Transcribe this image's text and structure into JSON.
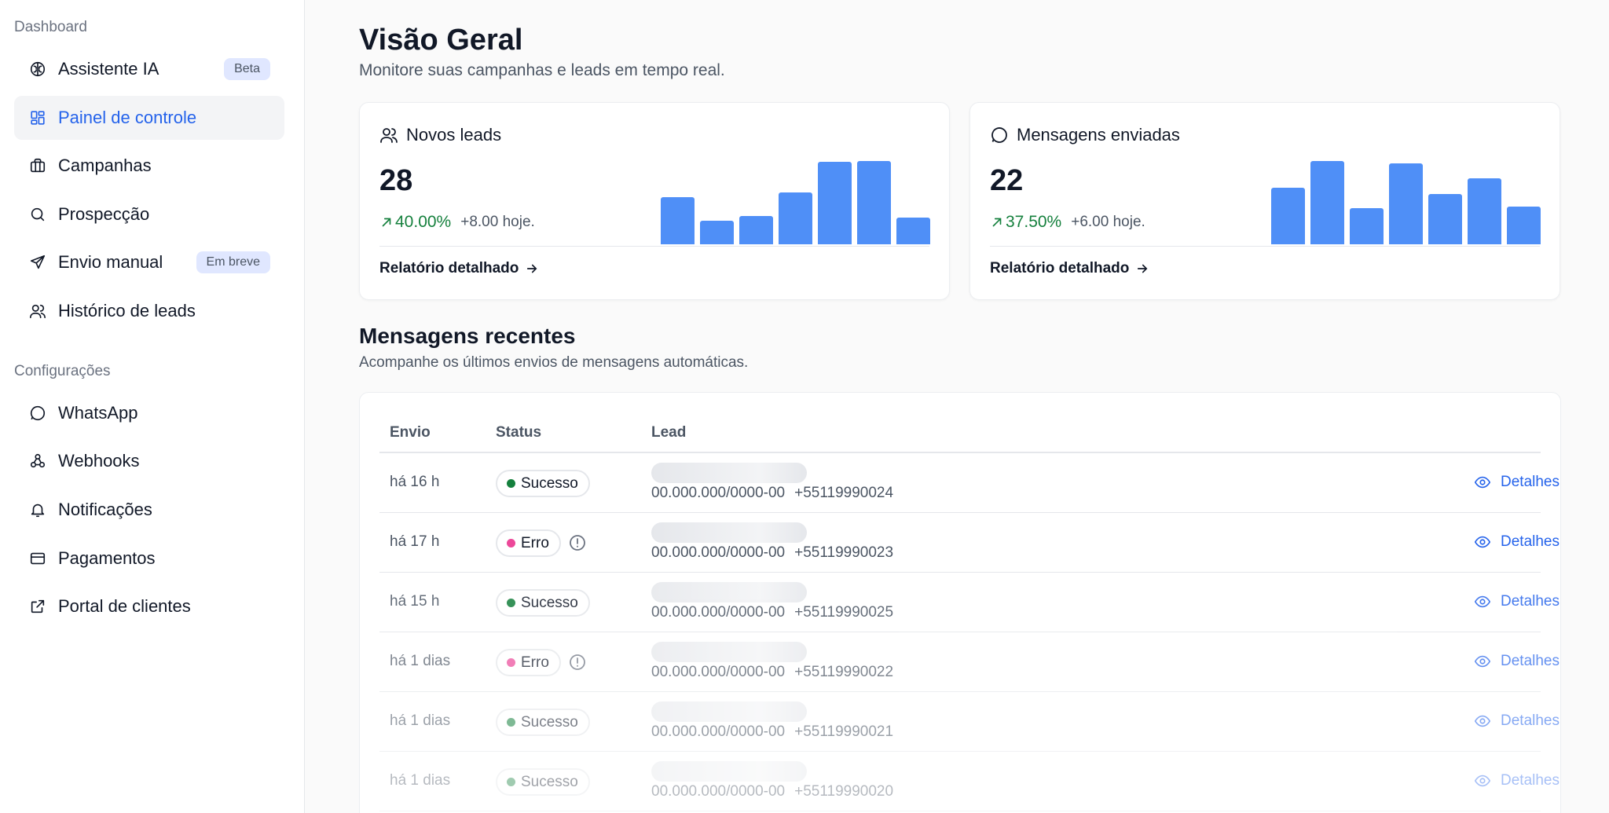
{
  "sidebar": {
    "sections": [
      {
        "label": "Dashboard"
      },
      {
        "label": "Configurações"
      }
    ],
    "items": [
      {
        "label": "Assistente IA",
        "icon": "brain-icon",
        "badge": "Beta"
      },
      {
        "label": "Painel de controle",
        "icon": "dashboard-icon",
        "active": true
      },
      {
        "label": "Campanhas",
        "icon": "briefcase-icon"
      },
      {
        "label": "Prospecção",
        "icon": "search-icon"
      },
      {
        "label": "Envio manual",
        "icon": "send-icon",
        "badge": "Em breve"
      },
      {
        "label": "Histórico de leads",
        "icon": "users-icon"
      },
      {
        "label": "WhatsApp",
        "icon": "message-circle-icon"
      },
      {
        "label": "Webhooks",
        "icon": "webhook-icon"
      },
      {
        "label": "Notificações",
        "icon": "bell-icon"
      },
      {
        "label": "Pagamentos",
        "icon": "credit-card-icon"
      },
      {
        "label": "Portal de clientes",
        "icon": "external-link-icon"
      }
    ]
  },
  "header": {
    "title": "Visão Geral",
    "subtitle": "Monitore suas campanhas e leads em tempo real."
  },
  "cards": [
    {
      "title": "Novos leads",
      "icon": "users-icon",
      "value": "28",
      "percent": "40.00%",
      "today": "+8.00 hoje.",
      "link": "Relatório detalhado",
      "bars": [
        4,
        2,
        2.4,
        4.4,
        7,
        7.1,
        2.3
      ]
    },
    {
      "title": "Mensagens enviadas",
      "icon": "message-circle-icon",
      "value": "22",
      "percent": "37.50%",
      "today": "+6.00 hoje.",
      "link": "Relatório detalhado",
      "bars": [
        4.8,
        7.1,
        3.1,
        6.9,
        4.3,
        5.6,
        3.2
      ]
    }
  ],
  "recent": {
    "title": "Mensagens recentes",
    "subtitle": "Acompanhe os últimos envios de mensagens automáticas.",
    "columns": [
      "Envio",
      "Status",
      "Lead"
    ],
    "details_label": "Detalhes",
    "rows": [
      {
        "envio": "há 16 h",
        "status": "Sucesso",
        "lead_doc": "00.000.000/0000-00",
        "phone": "+55119990024"
      },
      {
        "envio": "há 17 h",
        "status": "Erro",
        "lead_doc": "00.000.000/0000-00",
        "phone": "+55119990023"
      },
      {
        "envio": "há 15 h",
        "status": "Sucesso",
        "lead_doc": "00.000.000/0000-00",
        "phone": "+55119990025"
      },
      {
        "envio": "há 1 dias",
        "status": "Erro",
        "lead_doc": "00.000.000/0000-00",
        "phone": "+55119990022"
      },
      {
        "envio": "há 1 dias",
        "status": "Sucesso",
        "lead_doc": "00.000.000/0000-00",
        "phone": "+55119990021"
      },
      {
        "envio": "há 1 dias",
        "status": "Sucesso",
        "lead_doc": "00.000.000/0000-00",
        "phone": "+55119990020"
      }
    ]
  },
  "colors": {
    "accent": "#2563eb",
    "success_dot": "#15803d",
    "error_dot": "#ec4899",
    "bar": "#4f8ff7",
    "positive": "#15803d"
  }
}
